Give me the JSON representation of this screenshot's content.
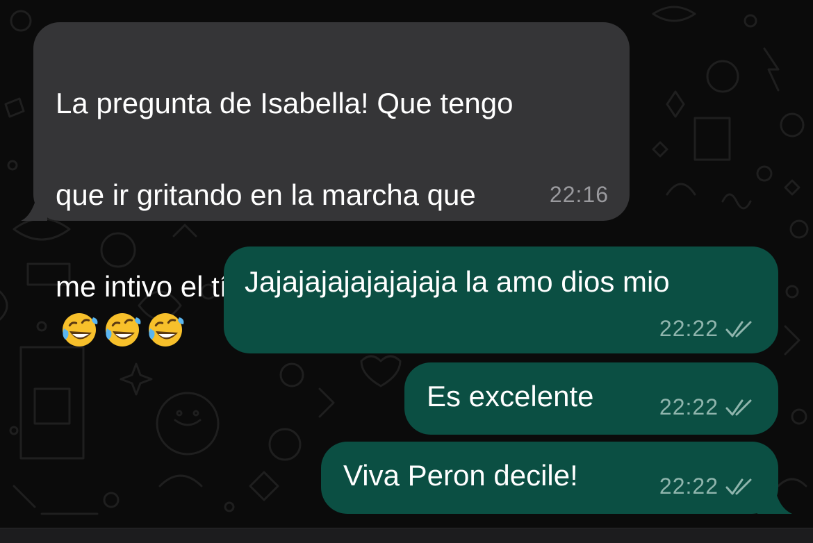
{
  "chat": {
    "messages": [
      {
        "direction": "incoming",
        "text_lines": [
          "La pregunta de Isabella! Que tengo",
          "que ir gritando en la marcha que",
          "me intivo el tío Pedro"
        ],
        "emoji": [
          "rolling-on-floor-laughing-icon",
          "rolling-on-floor-laughing-icon",
          "rolling-on-floor-laughing-icon"
        ],
        "time": "22:16"
      },
      {
        "direction": "outgoing",
        "text": "Jajajajajajajajaja la amo dios mio",
        "time": "22:22",
        "status": "read"
      },
      {
        "direction": "outgoing",
        "text": "Es excelente",
        "time": "22:22",
        "status": "read"
      },
      {
        "direction": "outgoing",
        "text": "Viva Peron decile!",
        "time": "22:22",
        "status": "read"
      }
    ]
  },
  "colors": {
    "background": "#0b0b0b",
    "incoming_bubble": "#353537",
    "outgoing_bubble": "#0b4f43",
    "read_ticks": "#8fb5ad"
  }
}
